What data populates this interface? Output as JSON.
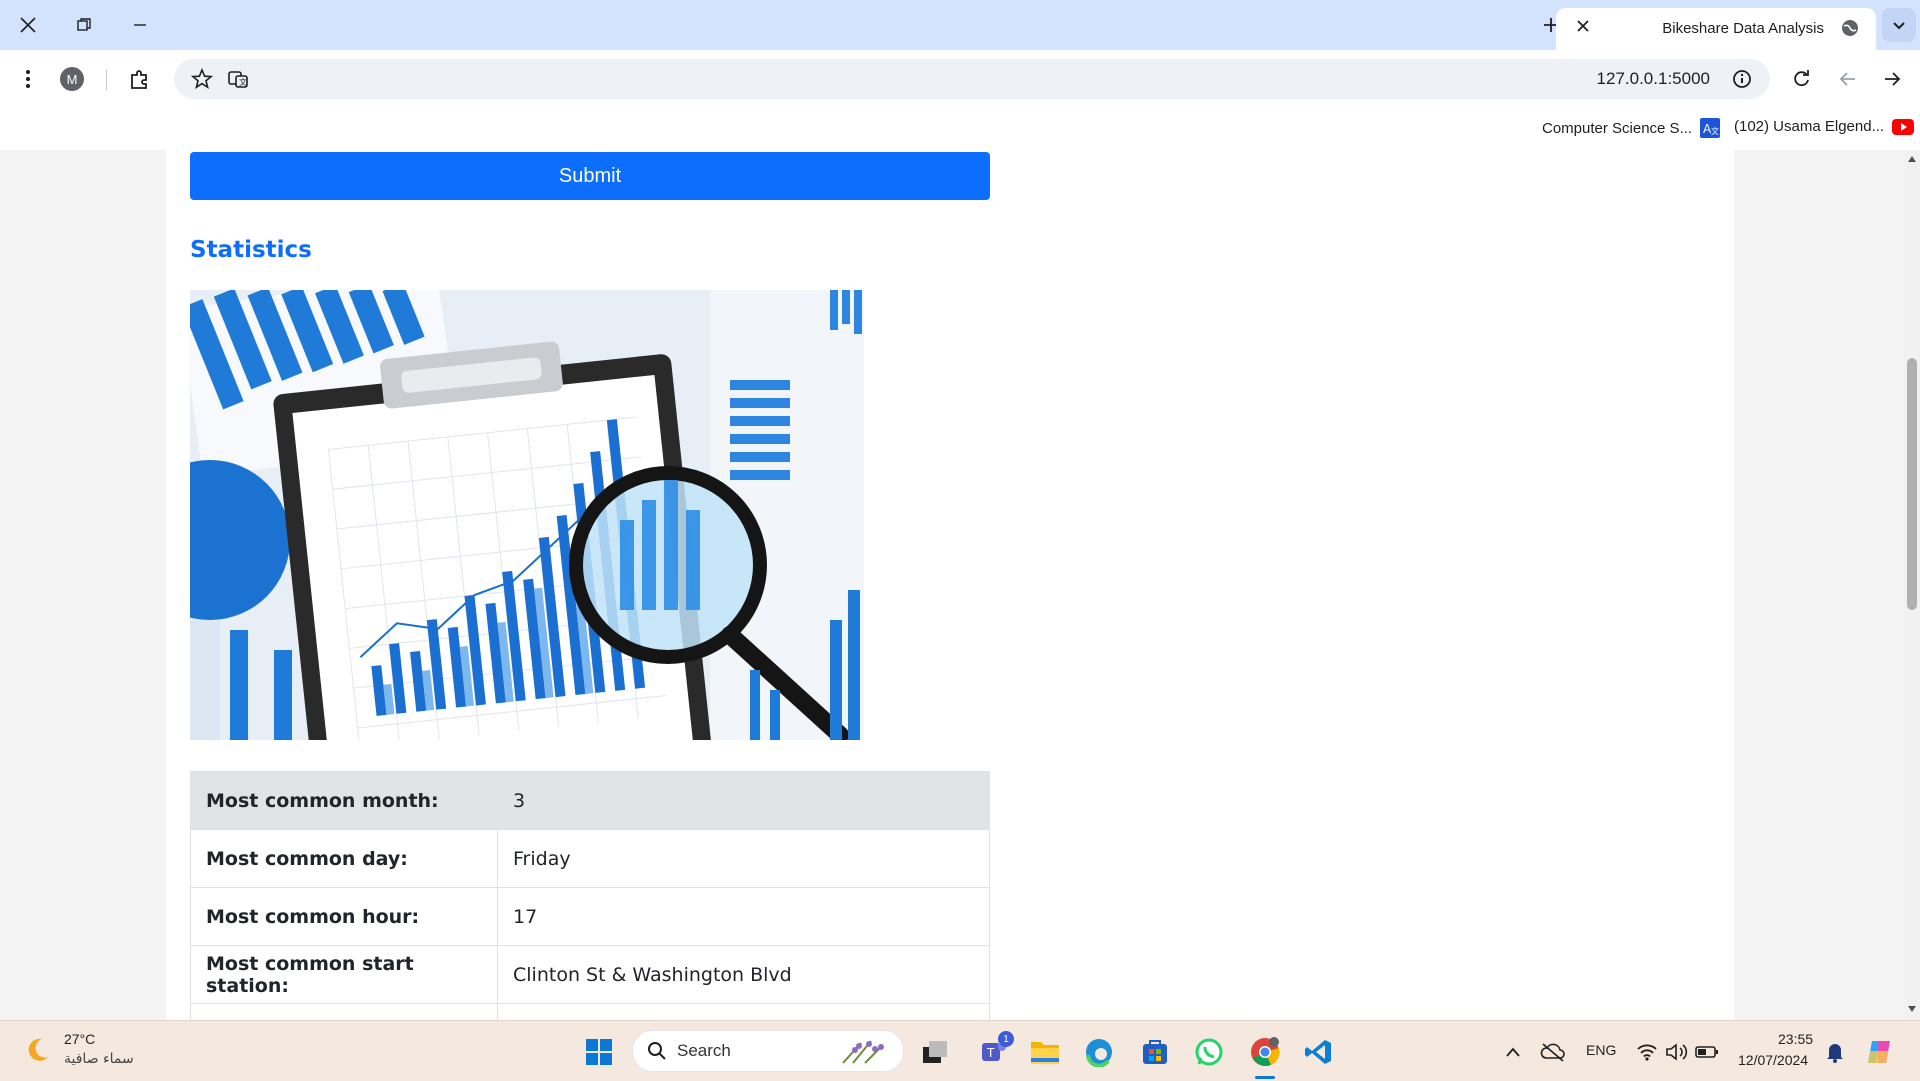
{
  "browser": {
    "tab_title": "Bikeshare Data Analysis",
    "url": "127.0.0.1:5000",
    "profile_initial": "M",
    "bookmarks": [
      {
        "label": "Computer Science S...",
        "icon": "translate-icon"
      },
      {
        "label": "(102) Usama Elgend...",
        "icon": "youtube-icon"
      }
    ]
  },
  "page": {
    "submit_label": "Submit",
    "statistics_heading": "Statistics",
    "stats": [
      {
        "label": "Most common month:",
        "value": "3"
      },
      {
        "label": "Most common day:",
        "value": "Friday"
      },
      {
        "label": "Most common hour:",
        "value": "17"
      },
      {
        "label": "Most common start station:",
        "value": "Clinton St & Washington Blvd"
      }
    ]
  },
  "taskbar": {
    "weather_temp": "27°C",
    "weather_desc": "سماء صافية",
    "search_label": "Search",
    "teams_badge": "1",
    "language": "ENG",
    "time": "23:55",
    "date": "12/07/2024"
  },
  "colors": {
    "accent": "#0d6efd",
    "titlebar": "#d3e3fd",
    "taskbar": "#f5e8df"
  }
}
